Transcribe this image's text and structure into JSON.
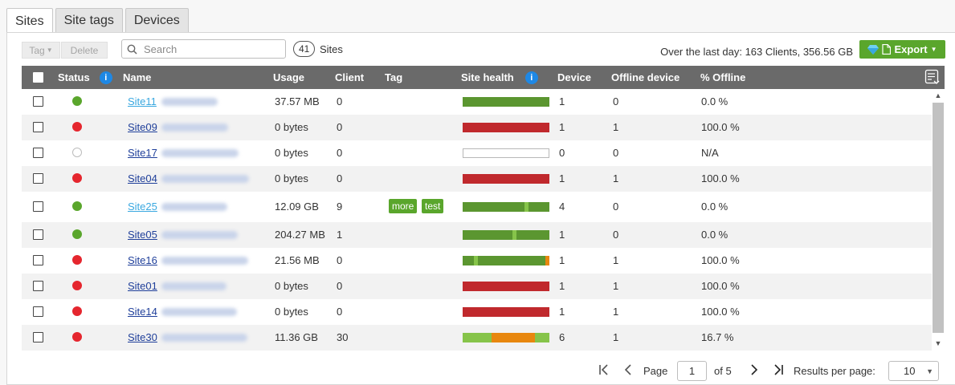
{
  "tabs": [
    {
      "label": "Sites",
      "active": true
    },
    {
      "label": "Site tags",
      "active": false
    },
    {
      "label": "Devices",
      "active": false
    }
  ],
  "toolbar": {
    "tag_label": "Tag",
    "delete_label": "Delete",
    "search_placeholder": "Search",
    "site_count": "41",
    "site_count_label": "Sites",
    "summary": "Over the last day: 163 Clients, 356.56 GB",
    "export_label": "Export"
  },
  "columns": {
    "status": "Status",
    "name": "Name",
    "usage": "Usage",
    "client": "Client",
    "tag": "Tag",
    "site_health": "Site health",
    "device": "Device",
    "offline_device": "Offline device",
    "pct_offline": "% Offline"
  },
  "rows": [
    {
      "status": "online",
      "site": "Site11",
      "visited": true,
      "usage": "37.57 MB",
      "client": "0",
      "tags": [],
      "health": [
        {
          "c": "#5b9630",
          "f": 1.0
        }
      ],
      "device": "1",
      "offline": "0",
      "pct": "0.0 %"
    },
    {
      "status": "offline",
      "site": "Site09",
      "visited": false,
      "usage": "0 bytes",
      "client": "0",
      "tags": [],
      "health": [
        {
          "c": "#c0292d",
          "f": 1.0
        }
      ],
      "device": "1",
      "offline": "1",
      "pct": "100.0 %"
    },
    {
      "status": "none",
      "site": "Site17",
      "visited": false,
      "usage": "0 bytes",
      "client": "0",
      "tags": [],
      "health": [],
      "device": "0",
      "offline": "0",
      "pct": "N/A"
    },
    {
      "status": "offline",
      "site": "Site04",
      "visited": false,
      "usage": "0 bytes",
      "client": "0",
      "tags": [],
      "health": [
        {
          "c": "#c0292d",
          "f": 1.0
        }
      ],
      "device": "1",
      "offline": "1",
      "pct": "100.0 %"
    },
    {
      "status": "online",
      "site": "Site25",
      "visited": true,
      "usage": "12.09 GB",
      "client": "9",
      "tags": [
        "more",
        "test"
      ],
      "health": [
        {
          "c": "#5b9630",
          "f": 0.71
        },
        {
          "c": "#86c44a",
          "f": 0.05
        },
        {
          "c": "#5b9630",
          "f": 0.24
        }
      ],
      "device": "4",
      "offline": "0",
      "pct": "0.0 %"
    },
    {
      "status": "online",
      "site": "Site05",
      "visited": false,
      "usage": "204.27 MB",
      "client": "1",
      "tags": [],
      "health": [
        {
          "c": "#5b9630",
          "f": 0.57
        },
        {
          "c": "#86c44a",
          "f": 0.05
        },
        {
          "c": "#5b9630",
          "f": 0.38
        }
      ],
      "device": "1",
      "offline": "0",
      "pct": "0.0 %"
    },
    {
      "status": "offline",
      "site": "Site16",
      "visited": false,
      "usage": "21.56 MB",
      "client": "0",
      "tags": [],
      "health": [
        {
          "c": "#5b9630",
          "f": 0.13
        },
        {
          "c": "#86c44a",
          "f": 0.05
        },
        {
          "c": "#5b9630",
          "f": 0.77
        },
        {
          "c": "#e8870f",
          "f": 0.05
        }
      ],
      "device": "1",
      "offline": "1",
      "pct": "100.0 %"
    },
    {
      "status": "offline",
      "site": "Site01",
      "visited": false,
      "usage": "0 bytes",
      "client": "0",
      "tags": [],
      "health": [
        {
          "c": "#c0292d",
          "f": 1.0
        }
      ],
      "device": "1",
      "offline": "1",
      "pct": "100.0 %"
    },
    {
      "status": "offline",
      "site": "Site14",
      "visited": false,
      "usage": "0 bytes",
      "client": "0",
      "tags": [],
      "health": [
        {
          "c": "#c0292d",
          "f": 1.0
        }
      ],
      "device": "1",
      "offline": "1",
      "pct": "100.0 %"
    },
    {
      "status": "offline",
      "site": "Site30",
      "visited": false,
      "usage": "11.36 GB",
      "client": "30",
      "tags": [],
      "health": [
        {
          "c": "#86c44a",
          "f": 0.33
        },
        {
          "c": "#e8870f",
          "f": 0.5
        },
        {
          "c": "#86c44a",
          "f": 0.17
        }
      ],
      "device": "6",
      "offline": "1",
      "pct": "16.7 %"
    }
  ],
  "pagination": {
    "page_label": "Page",
    "page": "1",
    "of_label": "of 5",
    "rpp_label": "Results per page:",
    "rpp_value": "10"
  },
  "colors": {
    "accent": "#5aa62c",
    "offline": "#e5262e",
    "header_bg": "#6a6a6a",
    "link": "#1f3f9a",
    "link_visited": "#3aa8e0"
  },
  "icons": {
    "export": "diamond-icon",
    "info": "info-icon",
    "columns": "column-settings-icon"
  }
}
